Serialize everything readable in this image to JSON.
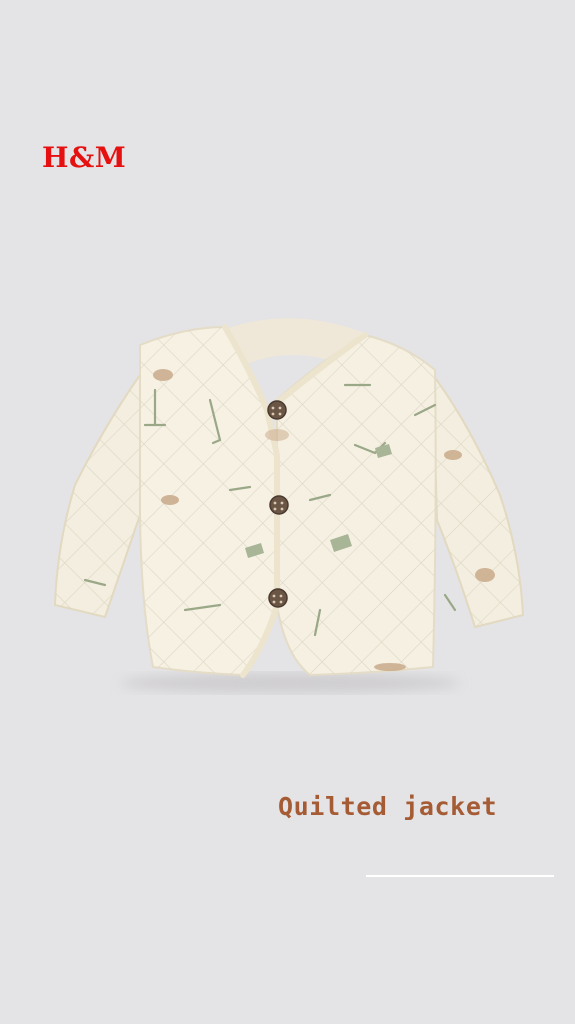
{
  "brand": {
    "logo_text": "H&M",
    "logo_color": "#e5100f"
  },
  "product": {
    "image_icon": "quilted-jacket-illustration",
    "title": "Quilted jacket",
    "title_color": "#a55c35"
  },
  "colors": {
    "background": "#e4e3e5",
    "divider": "#ffffff"
  }
}
